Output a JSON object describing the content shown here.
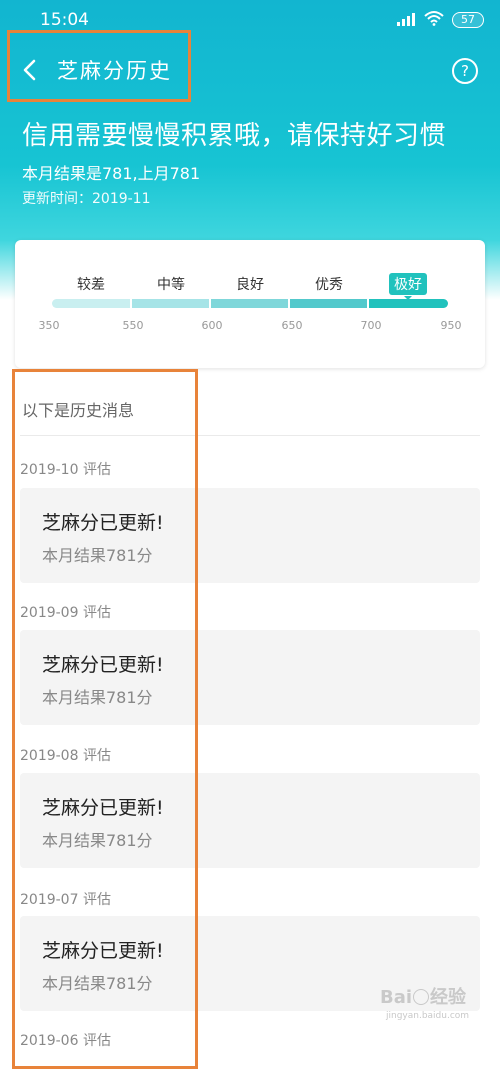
{
  "status": {
    "time": "15:04",
    "battery": "57"
  },
  "nav": {
    "title": "芝麻分历史",
    "back_icon": "chevron-left-icon",
    "help_label": "?"
  },
  "header": {
    "headline": "信用需要慢慢积累哦，请保持好习惯",
    "result": "本月结果是781,上月781",
    "updated": "更新时间：2019-11"
  },
  "scale": {
    "levels": [
      "较差",
      "中等",
      "良好",
      "优秀",
      "极好"
    ],
    "active_level": "极好",
    "ticks": [
      "350",
      "550",
      "600",
      "650",
      "700",
      "950"
    ]
  },
  "history": {
    "intro": "以下是历史消息",
    "items": [
      {
        "month": "2019-10 评估",
        "title": "芝麻分已更新!",
        "subtitle": "本月结果781分"
      },
      {
        "month": "2019-09 评估",
        "title": "芝麻分已更新!",
        "subtitle": "本月结果781分"
      },
      {
        "month": "2019-08 评估",
        "title": "芝麻分已更新!",
        "subtitle": "本月结果781分"
      },
      {
        "month": "2019-07 评估",
        "title": "芝麻分已更新!",
        "subtitle": "本月结果781分"
      },
      {
        "month": "2019-06 评估"
      }
    ]
  },
  "watermark": {
    "logo": "Bai",
    "logo_tail": "经验",
    "url": "jingyan.baidu.com"
  },
  "colors": {
    "header": "#12b5d0",
    "accent": "#21c2bd",
    "highlight_box": "#e8833a"
  }
}
